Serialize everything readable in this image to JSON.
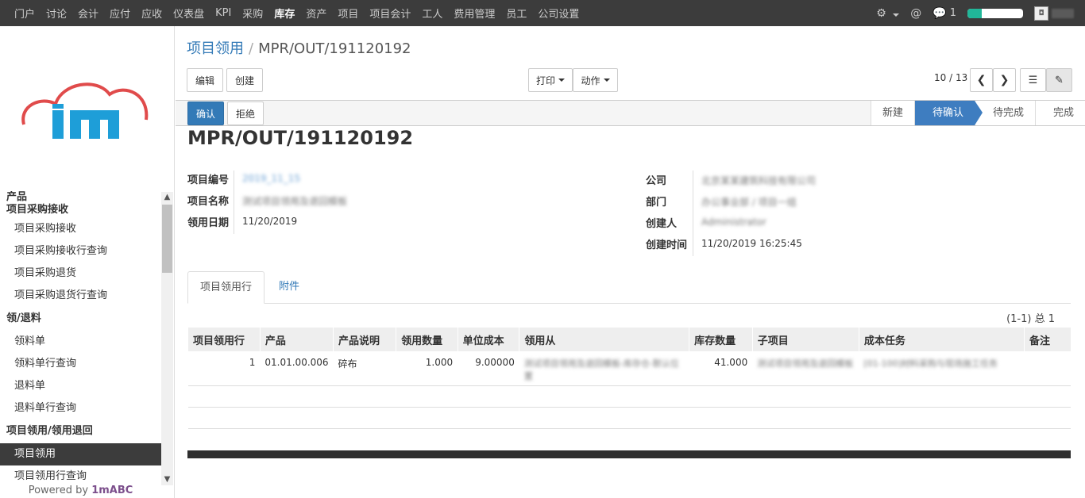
{
  "topnav": {
    "items": [
      "门户",
      "讨论",
      "会计",
      "应付",
      "应收",
      "仪表盘",
      "KPI",
      "采购",
      "库存",
      "资产",
      "项目",
      "项目会计",
      "工人",
      "费用管理",
      "员工",
      "公司设置"
    ],
    "active_index": 8,
    "message_count": "1",
    "progress": 0.25,
    "avatar_text": "◘"
  },
  "sidebar": {
    "cut_section": "产品",
    "sections": [
      {
        "title": "项目采购接收",
        "items": [
          "项目采购接收",
          "项目采购接收行查询",
          "项目采购退货",
          "项目采购退货行查询"
        ]
      },
      {
        "title": "领/退料",
        "items": [
          "领料单",
          "领料单行查询",
          "退料单",
          "退料单行查询"
        ]
      },
      {
        "title": "项目领用/领用退回",
        "items": [
          "项目领用",
          "项目领用行查询"
        ]
      }
    ],
    "active_item": "项目领用",
    "powered_prefix": "Powered by ",
    "powered_brand": "1mABC"
  },
  "breadcrumb": {
    "parent": "项目领用",
    "current": "MPR/OUT/191120192"
  },
  "toolbar": {
    "edit": "编辑",
    "create": "创建",
    "print": "打印",
    "action": "动作",
    "pager": "10 / 13"
  },
  "statusbar": {
    "confirm": "确认",
    "reject": "拒绝",
    "stages": [
      "新建",
      "待确认",
      "待完成",
      "完成"
    ],
    "current_stage": "待确认"
  },
  "record": {
    "title": "MPR/OUT/191120192",
    "left_fields": [
      {
        "label": "项目编号",
        "value": "2019_11_15",
        "blurred": true,
        "link": true
      },
      {
        "label": "项目名称",
        "value": "测试项目领用及退回模板",
        "blurred": true
      },
      {
        "label": "领用日期",
        "value": "11/20/2019"
      }
    ],
    "right_fields": [
      {
        "label": "公司",
        "value": "北京某某建筑科技有限公司",
        "blurred": true
      },
      {
        "label": "部门",
        "value": "办公事业部 / 项目一组",
        "blurred": true
      },
      {
        "label": "创建人",
        "value": "Administrator",
        "blurred": true
      },
      {
        "label": "创建时间",
        "value": "11/20/2019 16:25:45"
      }
    ]
  },
  "tabs": [
    "项目领用行",
    "附件"
  ],
  "list_pager": "(1-1) 总 1",
  "table": {
    "headers": [
      "项目领用行",
      "产品",
      "产品说明",
      "领用数量",
      "单位成本",
      "领用从",
      "库存数量",
      "子项目",
      "成本任务",
      "备注"
    ],
    "rows": [
      {
        "line": "1",
        "product": "01.01.00.006",
        "desc": "碎布",
        "qty": "1.000",
        "cost": "9.00000",
        "from": "测试项目领用及退回模板-库存仓-默认位置",
        "stock": "41.000",
        "sub": "测试项目领用及退回模板",
        "task": "[01-100]材料采购与现场施工任务",
        "note": ""
      }
    ]
  }
}
